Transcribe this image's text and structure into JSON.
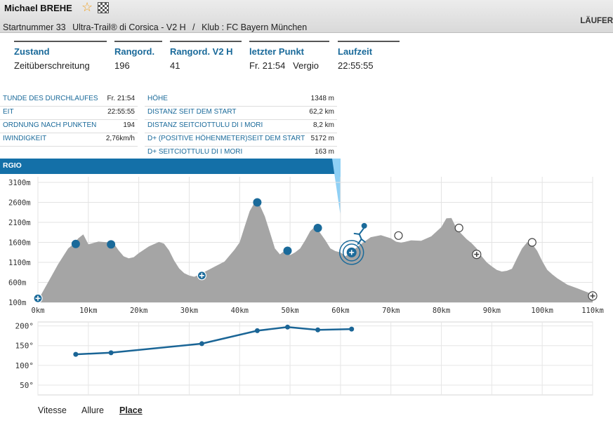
{
  "runner": {
    "name": "Michael BREHE",
    "bib": "Startnummer 33",
    "race": "Ultra-Trail® di Corsica - V2 H",
    "separator": "/",
    "club": "Klub : FC Bayern München"
  },
  "header_right_tab": "LÄUFER",
  "icons": {
    "favorite": "star-outline-icon",
    "finish": "checkered-flag-icon"
  },
  "summary": [
    {
      "label": "Zustand",
      "value": "Zeitüberschreitung"
    },
    {
      "label": "Rangord.",
      "value": "196"
    },
    {
      "label": "Rangord. V2 H",
      "value": "41"
    },
    {
      "label": "letzter Punkt",
      "value": "Fr. 21:54   Vergio"
    },
    {
      "label": "Laufzeit",
      "value": "22:55:55"
    }
  ],
  "details_left": [
    {
      "label": "TUNDE DES DURCHLAUFES",
      "value": "Fr. 21:54"
    },
    {
      "label": "EIT",
      "value": "22:55:55"
    },
    {
      "label": "ORDNUNG NACH PUNKTEN",
      "value": "194"
    },
    {
      "label": "IWINDIGKEIT",
      "value": "2,76km/h"
    }
  ],
  "details_right": [
    {
      "label": "HÖHE",
      "value": "1348 m"
    },
    {
      "label": "DISTANZ SEIT DEM START",
      "value": "62,2 km"
    },
    {
      "label": "DISTANZ SEITCIOTTULU DI I MORI",
      "value": "8,2 km"
    },
    {
      "label": "D+ (POSITIVE HÖHENMETER)SEIT DEM START",
      "value": "5172 m"
    },
    {
      "label": "D+ SEITCIOTTULU DI I MORI",
      "value": "163 m"
    }
  ],
  "banner_label": "RGIO",
  "tabs": [
    {
      "label": "Vitesse",
      "active": false
    },
    {
      "label": "Allure",
      "active": false
    },
    {
      "label": "Place",
      "active": true
    }
  ],
  "colors": {
    "accent": "#1470a8",
    "profile_fill": "#a5a5a5",
    "marker": "#1a6a9a"
  },
  "chart_data": [
    {
      "type": "area",
      "x_unit": "km",
      "y_unit": "m",
      "xlim": [
        0,
        110
      ],
      "ylim": [
        100,
        3100
      ],
      "x_ticks": [
        0,
        10,
        20,
        30,
        40,
        50,
        60,
        70,
        80,
        90,
        100,
        110
      ],
      "x_tick_labels": [
        "0km",
        "10km",
        "20km",
        "30km",
        "40km",
        "50km",
        "60km",
        "70km",
        "80km",
        "90km",
        "100km",
        "110km"
      ],
      "y_ticks": [
        100,
        600,
        1100,
        1600,
        2100,
        2600,
        3100
      ],
      "y_tick_labels": [
        "100m",
        "600m",
        "1100m",
        "1600m",
        "2100m",
        "2600m",
        "3100m"
      ],
      "grid": true,
      "profile": {
        "x": [
          0,
          2,
          4,
          6,
          7,
          8,
          9,
          10,
          12,
          14,
          15,
          16,
          17,
          18,
          19,
          20,
          22,
          24,
          25,
          26,
          27,
          28,
          29,
          30,
          31,
          32,
          33,
          35,
          37,
          39,
          40,
          41,
          42,
          43,
          44,
          45,
          46,
          47,
          48,
          49,
          50,
          51,
          52,
          53,
          54,
          55,
          56,
          57,
          58,
          59,
          60,
          61,
          62,
          64,
          66,
          68,
          70,
          71,
          72,
          74,
          76,
          78,
          80,
          81,
          82,
          83,
          84,
          85,
          86,
          87,
          88,
          89,
          90,
          91,
          92,
          93,
          94,
          95,
          96,
          97,
          98,
          99,
          100,
          101,
          102,
          103,
          105,
          107,
          109,
          110
        ],
        "y": [
          150,
          600,
          1050,
          1450,
          1550,
          1700,
          1800,
          1550,
          1620,
          1600,
          1580,
          1400,
          1250,
          1200,
          1230,
          1330,
          1500,
          1610,
          1570,
          1400,
          1150,
          950,
          830,
          770,
          740,
          790,
          860,
          990,
          1120,
          1420,
          1600,
          2000,
          2380,
          2600,
          2530,
          2250,
          1850,
          1450,
          1300,
          1400,
          1280,
          1350,
          1450,
          1650,
          1880,
          2000,
          1830,
          1650,
          1450,
          1380,
          1350,
          1250,
          1350,
          1550,
          1730,
          1780,
          1700,
          1620,
          1590,
          1650,
          1640,
          1750,
          1980,
          2200,
          2210,
          1950,
          1810,
          1680,
          1580,
          1450,
          1250,
          1100,
          1000,
          910,
          870,
          890,
          940,
          1200,
          1450,
          1600,
          1560,
          1390,
          1130,
          910,
          800,
          700,
          540,
          450,
          350,
          300
        ]
      },
      "markers": [
        {
          "x": 0,
          "y": 200,
          "label": "start",
          "kind": "plus"
        },
        {
          "x": 7.5,
          "y": 1560,
          "kind": "passed"
        },
        {
          "x": 14.5,
          "y": 1550,
          "kind": "passed"
        },
        {
          "x": 32.5,
          "y": 770,
          "kind": "plus"
        },
        {
          "x": 43.5,
          "y": 2600,
          "kind": "passed"
        },
        {
          "x": 49.5,
          "y": 1390,
          "kind": "passed"
        },
        {
          "x": 55.5,
          "y": 1960,
          "kind": "passed"
        },
        {
          "x": 62.2,
          "y": 1348,
          "kind": "current"
        },
        {
          "x": 71.5,
          "y": 1770,
          "kind": "pending"
        },
        {
          "x": 83.5,
          "y": 1960,
          "kind": "pending"
        },
        {
          "x": 87,
          "y": 1300,
          "kind": "plus"
        },
        {
          "x": 98,
          "y": 1600,
          "kind": "pending"
        },
        {
          "x": 110,
          "y": 260,
          "kind": "plus"
        }
      ]
    },
    {
      "type": "line",
      "ylim": [
        25,
        210
      ],
      "y_ticks": [
        50,
        100,
        150,
        200
      ],
      "y_tick_labels": [
        "50°",
        "100°",
        "150°",
        "200°"
      ],
      "grid": true,
      "series": [
        {
          "x": [
            7.5,
            14.5,
            32.5,
            43.5,
            49.5,
            55.5,
            62.2
          ],
          "y": [
            128,
            132,
            155,
            188,
            197,
            190,
            192
          ]
        }
      ]
    }
  ]
}
